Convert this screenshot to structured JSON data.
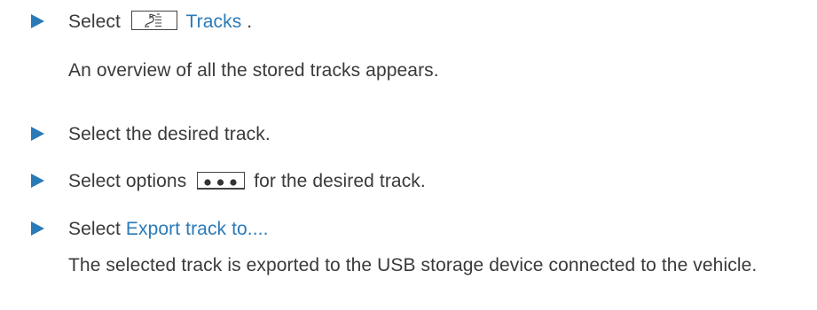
{
  "steps": [
    {
      "prefix": "Select",
      "icon": "track-route-icon",
      "ui_label": "Tracks",
      "suffix": " .",
      "result": "An overview of all the stored tracks appears."
    },
    {
      "text": "Select the desired track."
    },
    {
      "prefix": "Select options",
      "icon": "more-options-icon",
      "suffix": "for the desired track."
    },
    {
      "prefix": "Select ",
      "ui_label": "Export track to....",
      "result": "The selected track is exported to the USB storage device connected to the vehicle."
    }
  ],
  "colors": {
    "bullet": "#2a7ab8",
    "ui_label": "#2a7ab8",
    "body_text": "#3a3a3a"
  }
}
